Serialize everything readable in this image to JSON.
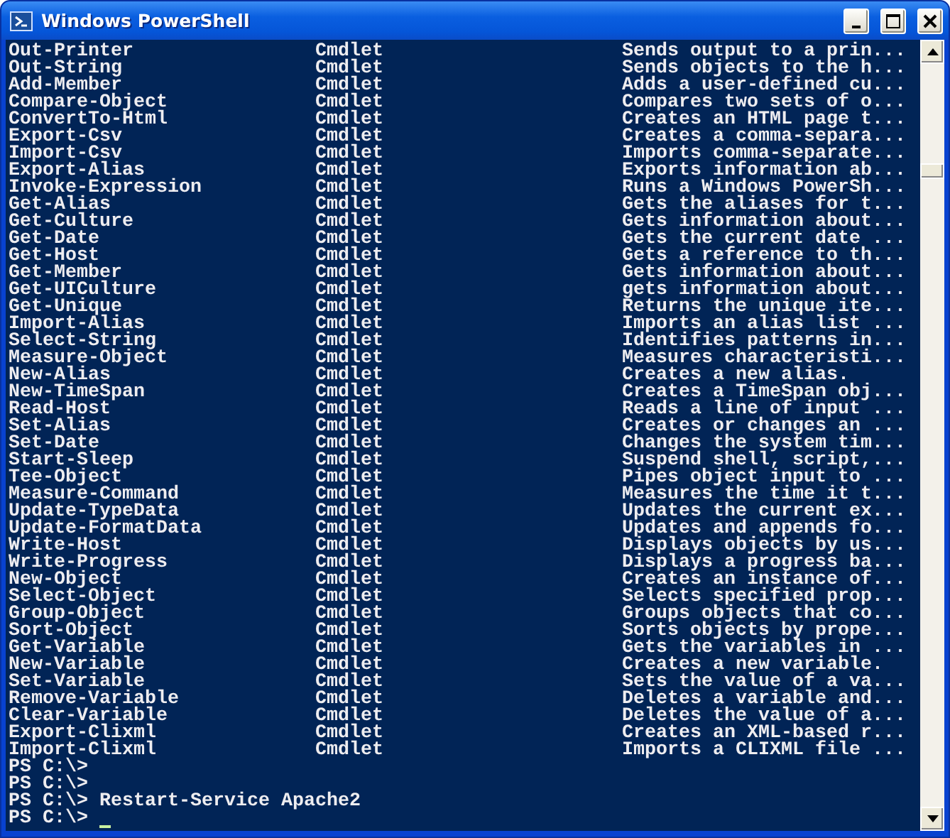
{
  "window": {
    "title": "Windows PowerShell"
  },
  "rows": [
    {
      "name": "Out-Printer",
      "type": "Cmdlet",
      "description": "Sends output to a prin..."
    },
    {
      "name": "Out-String",
      "type": "Cmdlet",
      "description": "Sends objects to the h..."
    },
    {
      "name": "Add-Member",
      "type": "Cmdlet",
      "description": "Adds a user-defined cu..."
    },
    {
      "name": "Compare-Object",
      "type": "Cmdlet",
      "description": "Compares two sets of o..."
    },
    {
      "name": "ConvertTo-Html",
      "type": "Cmdlet",
      "description": "Creates an HTML page t..."
    },
    {
      "name": "Export-Csv",
      "type": "Cmdlet",
      "description": "Creates a comma-separa..."
    },
    {
      "name": "Import-Csv",
      "type": "Cmdlet",
      "description": "Imports comma-separate..."
    },
    {
      "name": "Export-Alias",
      "type": "Cmdlet",
      "description": "Exports information ab..."
    },
    {
      "name": "Invoke-Expression",
      "type": "Cmdlet",
      "description": "Runs a Windows PowerSh..."
    },
    {
      "name": "Get-Alias",
      "type": "Cmdlet",
      "description": "Gets the aliases for t..."
    },
    {
      "name": "Get-Culture",
      "type": "Cmdlet",
      "description": "Gets information about..."
    },
    {
      "name": "Get-Date",
      "type": "Cmdlet",
      "description": "Gets the current date ..."
    },
    {
      "name": "Get-Host",
      "type": "Cmdlet",
      "description": "Gets a reference to th..."
    },
    {
      "name": "Get-Member",
      "type": "Cmdlet",
      "description": "Gets information about..."
    },
    {
      "name": "Get-UICulture",
      "type": "Cmdlet",
      "description": "gets information about..."
    },
    {
      "name": "Get-Unique",
      "type": "Cmdlet",
      "description": "Returns the unique ite..."
    },
    {
      "name": "Import-Alias",
      "type": "Cmdlet",
      "description": "Imports an alias list ..."
    },
    {
      "name": "Select-String",
      "type": "Cmdlet",
      "description": "Identifies patterns in..."
    },
    {
      "name": "Measure-Object",
      "type": "Cmdlet",
      "description": "Measures characteristi..."
    },
    {
      "name": "New-Alias",
      "type": "Cmdlet",
      "description": "Creates a new alias."
    },
    {
      "name": "New-TimeSpan",
      "type": "Cmdlet",
      "description": "Creates a TimeSpan obj..."
    },
    {
      "name": "Read-Host",
      "type": "Cmdlet",
      "description": "Reads a line of input ..."
    },
    {
      "name": "Set-Alias",
      "type": "Cmdlet",
      "description": "Creates or changes an ..."
    },
    {
      "name": "Set-Date",
      "type": "Cmdlet",
      "description": "Changes the system tim..."
    },
    {
      "name": "Start-Sleep",
      "type": "Cmdlet",
      "description": "Suspend shell, script,..."
    },
    {
      "name": "Tee-Object",
      "type": "Cmdlet",
      "description": "Pipes object input to ..."
    },
    {
      "name": "Measure-Command",
      "type": "Cmdlet",
      "description": "Measures the time it t..."
    },
    {
      "name": "Update-TypeData",
      "type": "Cmdlet",
      "description": "Updates the current ex..."
    },
    {
      "name": "Update-FormatData",
      "type": "Cmdlet",
      "description": "Updates and appends fo..."
    },
    {
      "name": "Write-Host",
      "type": "Cmdlet",
      "description": "Displays objects by us..."
    },
    {
      "name": "Write-Progress",
      "type": "Cmdlet",
      "description": "Displays a progress ba..."
    },
    {
      "name": "New-Object",
      "type": "Cmdlet",
      "description": "Creates an instance of..."
    },
    {
      "name": "Select-Object",
      "type": "Cmdlet",
      "description": "Selects specified prop..."
    },
    {
      "name": "Group-Object",
      "type": "Cmdlet",
      "description": "Groups objects that co..."
    },
    {
      "name": "Sort-Object",
      "type": "Cmdlet",
      "description": "Sorts objects by prope..."
    },
    {
      "name": "Get-Variable",
      "type": "Cmdlet",
      "description": "Gets the variables in ..."
    },
    {
      "name": "New-Variable",
      "type": "Cmdlet",
      "description": "Creates a new variable."
    },
    {
      "name": "Set-Variable",
      "type": "Cmdlet",
      "description": "Sets the value of a va..."
    },
    {
      "name": "Remove-Variable",
      "type": "Cmdlet",
      "description": "Deletes a variable and..."
    },
    {
      "name": "Clear-Variable",
      "type": "Cmdlet",
      "description": "Deletes the value of a..."
    },
    {
      "name": "Export-Clixml",
      "type": "Cmdlet",
      "description": "Creates an XML-based r..."
    },
    {
      "name": "Import-Clixml",
      "type": "Cmdlet",
      "description": "Imports a CLIXML file ..."
    }
  ],
  "prompt_lines": [
    "PS C:\\>",
    "PS C:\\>",
    "PS C:\\> Restart-Service Apache2",
    "PS C:\\>"
  ]
}
